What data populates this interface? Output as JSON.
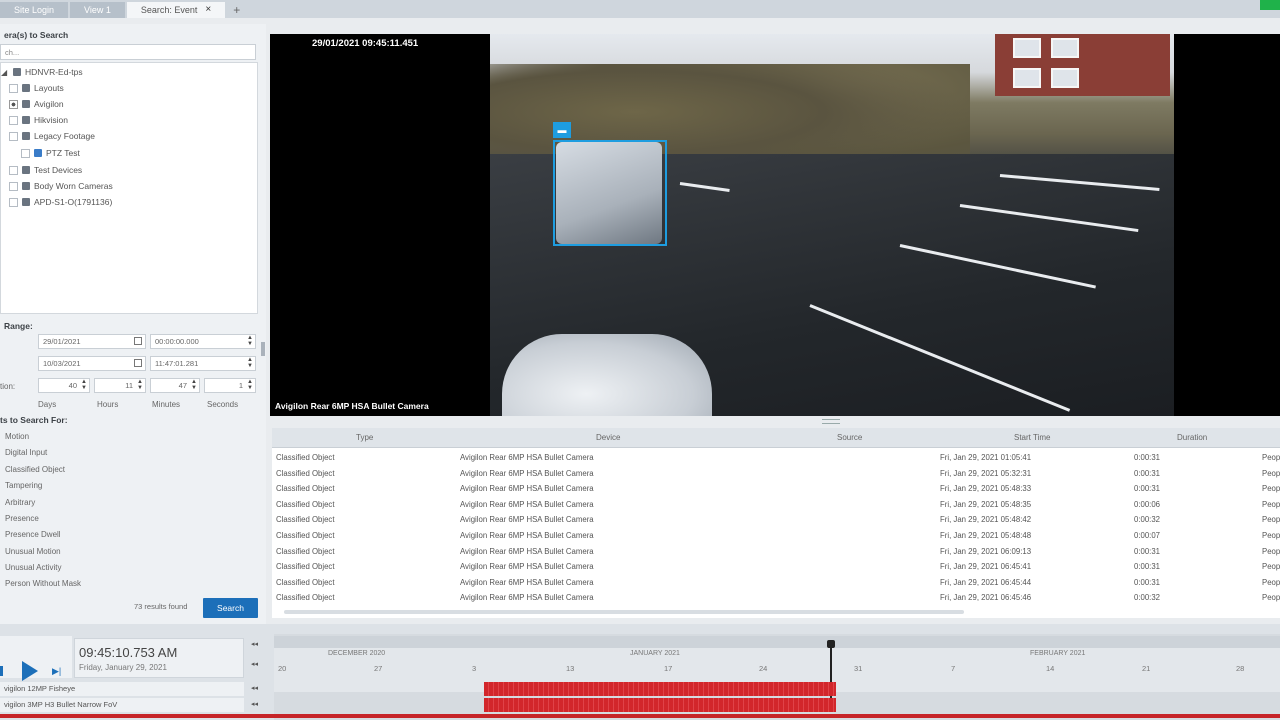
{
  "tabs": [
    {
      "label": "Site Login"
    },
    {
      "label": "View 1"
    },
    {
      "label": "Search: Event",
      "active": true
    }
  ],
  "left": {
    "cameras_header": "era(s) to Search",
    "search_placeholder": "ch...",
    "tree": [
      {
        "label": "HDNVR-Ed-tps",
        "indent": 0,
        "icon": "server-icon"
      },
      {
        "label": "Layouts",
        "indent": 1,
        "icon": "folder-icon"
      },
      {
        "label": "Avigilon",
        "indent": 1,
        "icon": "folder-icon",
        "partial": true
      },
      {
        "label": "Hikvision",
        "indent": 1,
        "icon": "folder-icon"
      },
      {
        "label": "Legacy Footage",
        "indent": 1,
        "icon": "folder-icon"
      },
      {
        "label": "PTZ Test",
        "indent": 2,
        "icon": "camera-icon"
      },
      {
        "label": "Test Devices",
        "indent": 1,
        "icon": "folder-icon"
      },
      {
        "label": "Body Worn Cameras",
        "indent": 1,
        "icon": "folder-icon"
      },
      {
        "label": "APD-S1-O(1791136)",
        "indent": 1,
        "icon": "person-icon"
      }
    ],
    "range_header": "Range:",
    "from_date": "29/01/2021",
    "from_time": "00:00:00.000",
    "to_date": "10/03/2021",
    "to_time": "11:47:01.281",
    "duration_label": "tion:",
    "duration": {
      "days": "40",
      "hours": "11",
      "minutes": "47",
      "seconds": "1"
    },
    "duration_units": {
      "days": "Days",
      "hours": "Hours",
      "minutes": "Minutes",
      "seconds": "Seconds"
    },
    "events_header": "ts to Search For:",
    "events": [
      "Motion",
      "Digital Input",
      "Classified Object",
      "Tampering",
      "Arbitrary",
      "Presence",
      "Presence Dwell",
      "Unusual Motion",
      "Unusual Activity",
      "Person Without Mask"
    ],
    "results": "73 results found",
    "search_button": "Search"
  },
  "video": {
    "timestamp": "29/01/2021 09:45:11.451",
    "camera_name": "Avigilon Rear 6MP HSA Bullet Camera"
  },
  "table": {
    "headers": {
      "type": "Type",
      "device": "Device",
      "source": "Source",
      "start": "Start Time",
      "duration": "Duration"
    },
    "rows": [
      {
        "type": "Classified Object",
        "device": "Avigilon Rear 6MP HSA Bullet Camera",
        "start": "Fri, Jan 29, 2021 01:05:41",
        "duration": "0:00:31",
        "extra": "Peop"
      },
      {
        "type": "Classified Object",
        "device": "Avigilon Rear 6MP HSA Bullet Camera",
        "start": "Fri, Jan 29, 2021 05:32:31",
        "duration": "0:00:31",
        "extra": "Peop"
      },
      {
        "type": "Classified Object",
        "device": "Avigilon Rear 6MP HSA Bullet Camera",
        "start": "Fri, Jan 29, 2021 05:48:33",
        "duration": "0:00:31",
        "extra": "Peop"
      },
      {
        "type": "Classified Object",
        "device": "Avigilon Rear 6MP HSA Bullet Camera",
        "start": "Fri, Jan 29, 2021 05:48:35",
        "duration": "0:00:06",
        "extra": "Peop"
      },
      {
        "type": "Classified Object",
        "device": "Avigilon Rear 6MP HSA Bullet Camera",
        "start": "Fri, Jan 29, 2021 05:48:42",
        "duration": "0:00:32",
        "extra": "Peop"
      },
      {
        "type": "Classified Object",
        "device": "Avigilon Rear 6MP HSA Bullet Camera",
        "start": "Fri, Jan 29, 2021 05:48:48",
        "duration": "0:00:07",
        "extra": "Peop"
      },
      {
        "type": "Classified Object",
        "device": "Avigilon Rear 6MP HSA Bullet Camera",
        "start": "Fri, Jan 29, 2021 06:09:13",
        "duration": "0:00:31",
        "extra": "Peop"
      },
      {
        "type": "Classified Object",
        "device": "Avigilon Rear 6MP HSA Bullet Camera",
        "start": "Fri, Jan 29, 2021 06:45:41",
        "duration": "0:00:31",
        "extra": "Peop"
      },
      {
        "type": "Classified Object",
        "device": "Avigilon Rear 6MP HSA Bullet Camera",
        "start": "Fri, Jan 29, 2021 06:45:44",
        "duration": "0:00:31",
        "extra": "Peop"
      },
      {
        "type": "Classified Object",
        "device": "Avigilon Rear 6MP HSA Bullet Camera",
        "start": "Fri, Jan 29, 2021 06:45:46",
        "duration": "0:00:32",
        "extra": "Peop"
      }
    ]
  },
  "playback": {
    "time": "09:45:10.753 AM",
    "date": "Friday, January 29, 2021",
    "months": [
      "DECEMBER 2020",
      "JANUARY 2021",
      "FEBRUARY 2021"
    ],
    "days": [
      "20",
      "27",
      "3",
      "13",
      "17",
      "24",
      "31",
      "7",
      "14",
      "21",
      "28"
    ],
    "cameras": [
      "vigilon 12MP Fisheye",
      "vigilon 3MP H3 Bullet Narrow FoV"
    ]
  },
  "colors": {
    "accent": "#1c6fb9",
    "bbox": "#1e9de0",
    "recording": "#d2262b"
  }
}
